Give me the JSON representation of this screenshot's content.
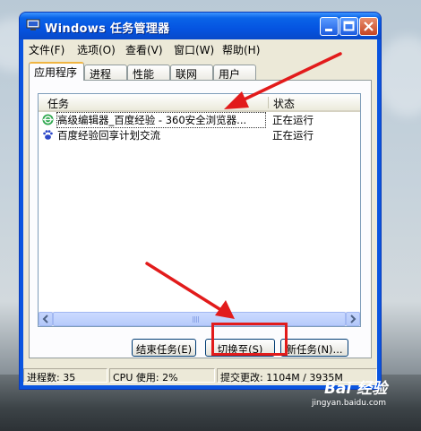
{
  "window": {
    "title": "Windows 任务管理器",
    "accent": "#0554e1"
  },
  "menu": [
    "文件(F)",
    "选项(O)",
    "查看(V)",
    "窗口(W)",
    "帮助(H)"
  ],
  "tabs": [
    {
      "label": "应用程序",
      "active": true
    },
    {
      "label": "进程",
      "active": false
    },
    {
      "label": "性能",
      "active": false
    },
    {
      "label": "联网",
      "active": false
    },
    {
      "label": "用户",
      "active": false
    }
  ],
  "list": {
    "columns": [
      "任务",
      "状态"
    ],
    "rows": [
      {
        "name": "高级编辑器_百度经验 - 360安全浏览器...",
        "status": "正在运行",
        "icon": "browser-icon",
        "selected": true
      },
      {
        "name": "百度经验回享计划交流",
        "status": "正在运行",
        "icon": "baidu-paw-icon",
        "selected": false
      }
    ]
  },
  "buttons": {
    "end_task": "结束任务(E)",
    "switch_to": "切换至(S)",
    "new_task": "新任务(N)..."
  },
  "statusbar": {
    "processes": "进程数: 35",
    "cpu": "CPU 使用: 2%",
    "commit": "提交更改: 1104M / 3935M"
  },
  "annotations": {
    "highlight_color": "#e21b1b"
  },
  "watermark": {
    "logo": "Bai 经验",
    "url": "jingyan.baidu.com"
  }
}
